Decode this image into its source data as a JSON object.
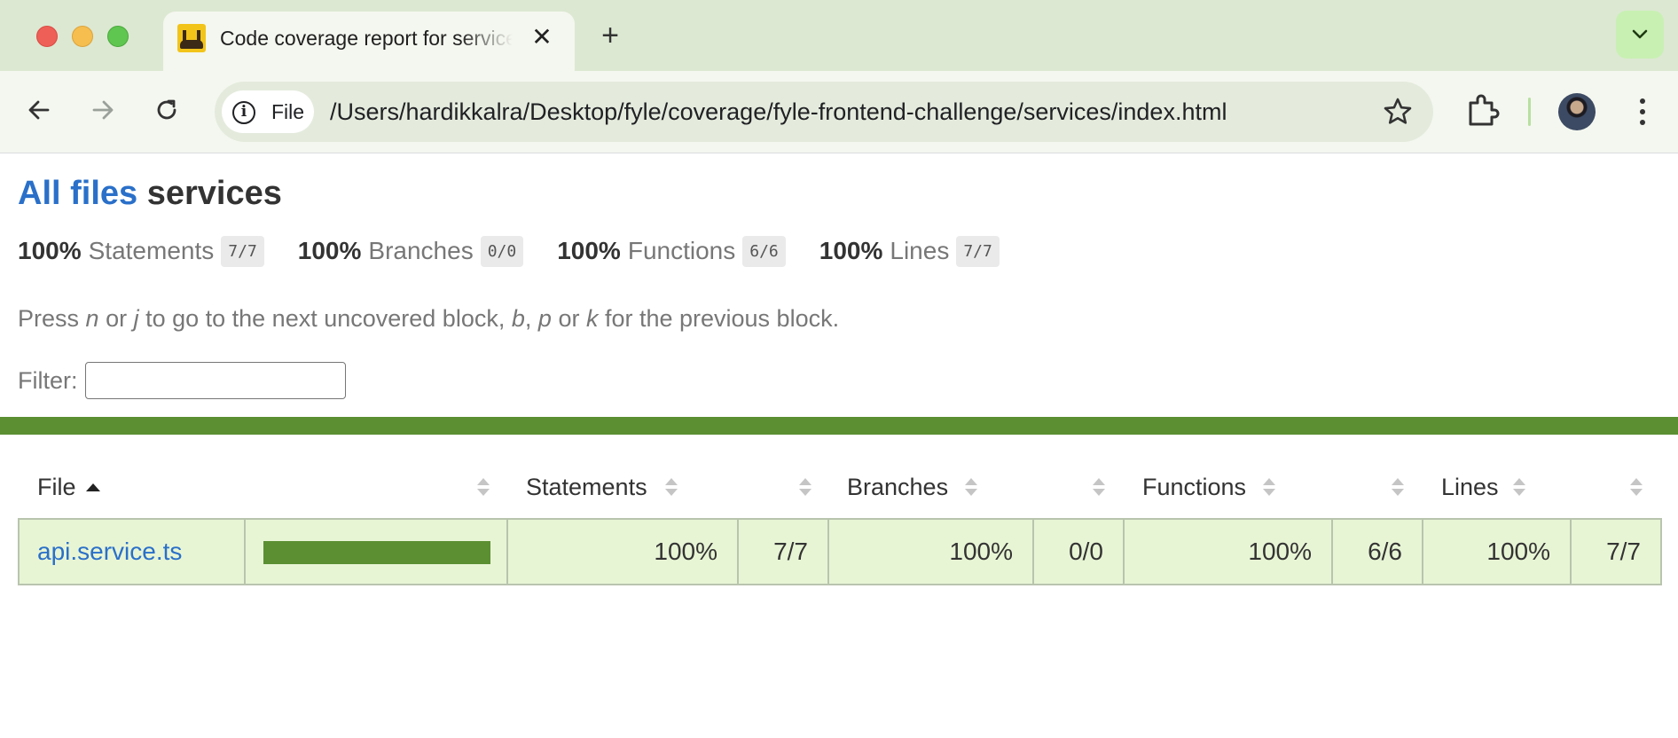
{
  "browser": {
    "tab_title": "Code coverage report for services",
    "new_tab_symbol": "+",
    "tab_close_symbol": "✕",
    "site_chip_label": "File",
    "url": "/Users/hardikkalra/Desktop/fyle/coverage/fyle-frontend-challenge/services/index.html"
  },
  "page": {
    "breadcrumb_link": "All files",
    "breadcrumb_current": "services",
    "summary": [
      {
        "pct": "100%",
        "label": "Statements",
        "frac": "7/7"
      },
      {
        "pct": "100%",
        "label": "Branches",
        "frac": "0/0"
      },
      {
        "pct": "100%",
        "label": "Functions",
        "frac": "6/6"
      },
      {
        "pct": "100%",
        "label": "Lines",
        "frac": "7/7"
      }
    ],
    "hint": {
      "t1": "Press ",
      "k1": "n",
      "t2": " or ",
      "k2": "j",
      "t3": " to go to the next uncovered block, ",
      "k3": "b",
      "t4": ", ",
      "k4": "p",
      "t5": " or ",
      "k5": "k",
      "t6": " for the previous block."
    },
    "filter_label": "Filter:",
    "filter_value": "",
    "status_color": "#5b8f32"
  },
  "table": {
    "headers": {
      "file": "File",
      "statements": "Statements",
      "branches": "Branches",
      "functions": "Functions",
      "lines": "Lines"
    },
    "sorted_by": "File",
    "sort_direction": "ascending",
    "rows": [
      {
        "file": "api.service.ts",
        "coverage_fraction": 1.0,
        "statements_pct": "100%",
        "statements_frac": "7/7",
        "branches_pct": "100%",
        "branches_frac": "0/0",
        "functions_pct": "100%",
        "functions_frac": "6/6",
        "lines_pct": "100%",
        "lines_frac": "7/7"
      }
    ]
  },
  "colors": {
    "link": "#2a70c9",
    "high_coverage_bg": "#e8f5d5",
    "high_coverage_bar": "#5b8f32"
  }
}
